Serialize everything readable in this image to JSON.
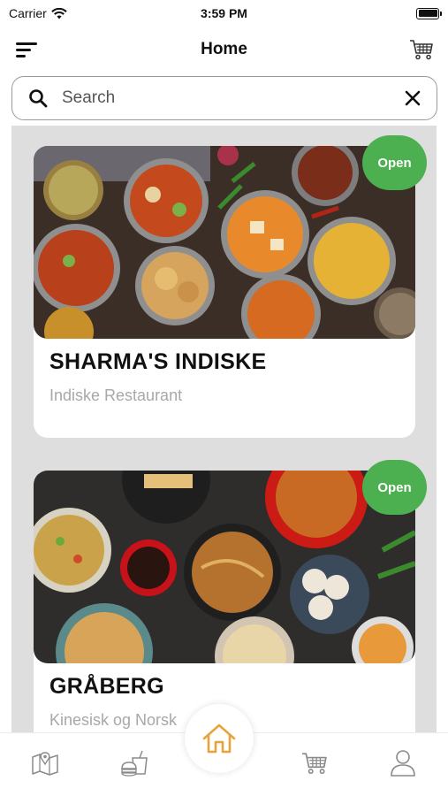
{
  "status_bar": {
    "carrier": "Carrier",
    "time": "3:59 PM"
  },
  "header": {
    "title": "Home",
    "menu_icon": "menu-icon",
    "cart_icon": "cart-icon"
  },
  "search": {
    "placeholder": "Search",
    "value": ""
  },
  "restaurants": [
    {
      "name": "SHARMA'S INDISKE",
      "subtitle": "Indiske Restaurant",
      "status": "Open"
    },
    {
      "name": "GRÅBERG",
      "subtitle": "Kinesisk og Norsk",
      "status": "Open"
    }
  ],
  "bottom_nav": {
    "items": [
      "map-icon",
      "food-icon",
      "home-icon",
      "cart-icon",
      "profile-icon"
    ],
    "active": "home-icon"
  },
  "colors": {
    "accent_green": "#4caf50",
    "home_orange": "#e8a33c",
    "nav_grey": "#8a8a8a"
  }
}
